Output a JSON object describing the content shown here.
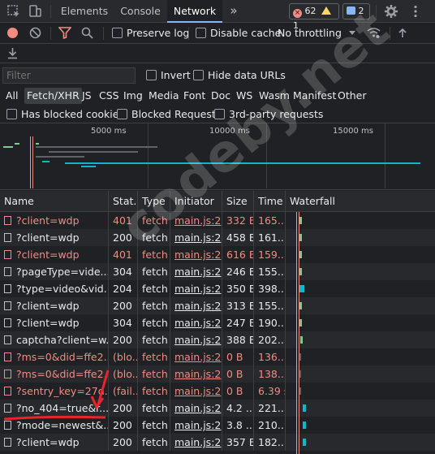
{
  "tabs": {
    "items": [
      {
        "label": "Elements"
      },
      {
        "label": "Console"
      },
      {
        "label": "Network"
      }
    ],
    "more": "»",
    "errors_count": "62",
    "warnings_count": "1",
    "messages_count": "2"
  },
  "toolbar": {
    "preserve_log": "Preserve log",
    "disable_cache": "Disable cache",
    "throttling": "No throttling"
  },
  "filter": {
    "placeholder": "Filter",
    "invert": "Invert",
    "hide_data_urls": "Hide data URLs"
  },
  "types": [
    "All",
    "Fetch/XHR",
    "JS",
    "CSS",
    "Img",
    "Media",
    "Font",
    "Doc",
    "WS",
    "Wasm",
    "Manifest",
    "Other"
  ],
  "blocked": {
    "has_blocked_cookies": "Has blocked cookies",
    "blocked_requests": "Blocked Requests",
    "third_party": "3rd-party requests"
  },
  "overview": {
    "ticks": [
      "5000 ms",
      "10000 ms",
      "15000 ms"
    ]
  },
  "table": {
    "headers": [
      "Name",
      "Stat...",
      "Type",
      "Initiator",
      "Size",
      "Time",
      "Waterfall"
    ],
    "rows": [
      {
        "name": "?client=wdp",
        "status": "401",
        "type": "fetch",
        "initiator": "main.js:2",
        "size": "332 B",
        "time": "165...",
        "error": true
      },
      {
        "name": "?client=wdp",
        "status": "200",
        "type": "fetch",
        "initiator": "main.js:2",
        "size": "458 B",
        "time": "161...",
        "error": false
      },
      {
        "name": "?client=wdp",
        "status": "401",
        "type": "fetch",
        "initiator": "main.js:2",
        "size": "616 B",
        "time": "159...",
        "error": true
      },
      {
        "name": "?pageType=vide...",
        "status": "304",
        "type": "fetch",
        "initiator": "main.js:2",
        "size": "246 B",
        "time": "155...",
        "error": false
      },
      {
        "name": "?type=video&vid...",
        "status": "204",
        "type": "fetch",
        "initiator": "main.js:2",
        "size": "350 B",
        "time": "398...",
        "error": false
      },
      {
        "name": "?client=wdp",
        "status": "200",
        "type": "fetch",
        "initiator": "main.js:2",
        "size": "313 B",
        "time": "155...",
        "error": false
      },
      {
        "name": "?client=wdp",
        "status": "304",
        "type": "fetch",
        "initiator": "main.js:2",
        "size": "247 B",
        "time": "190...",
        "error": false
      },
      {
        "name": "captcha?client=w...",
        "status": "200",
        "type": "fetch",
        "initiator": "main.js:2",
        "size": "388 B",
        "time": "202...",
        "error": false
      },
      {
        "name": "?ms=0&did=ffe2...",
        "status": "(blo...",
        "type": "fetch",
        "initiator": "main.js:2",
        "size": "0 B",
        "time": "136...",
        "error": true
      },
      {
        "name": "?ms=0&did=ffe2...",
        "status": "(blo...",
        "type": "fetch",
        "initiator": "main.js:2",
        "size": "0 B",
        "time": "138...",
        "error": true
      },
      {
        "name": "?sentry_key=27d...",
        "status": "(fail...",
        "type": "fetch",
        "initiator": "main.js:2",
        "size": "0 B",
        "time": "6.39 s",
        "error": true
      },
      {
        "name": "?no_404=true&r...",
        "status": "200",
        "type": "fetch",
        "initiator": "main.js:2",
        "size": "4.2 ...",
        "time": "221...",
        "error": false
      },
      {
        "name": "?mode=newest&...",
        "status": "200",
        "type": "fetch",
        "initiator": "main.js:2",
        "size": "3.8 ...",
        "time": "210...",
        "error": false
      },
      {
        "name": "?client=wdp",
        "status": "200",
        "type": "fetch",
        "initiator": "main.js:2",
        "size": "357 B",
        "time": "182...",
        "error": false
      }
    ]
  },
  "watermark": "codeby.net",
  "colors": {
    "accent": "#8ab4f8",
    "error": "#f28b82",
    "record": "#f28b82",
    "annotation": "#e8242c"
  }
}
